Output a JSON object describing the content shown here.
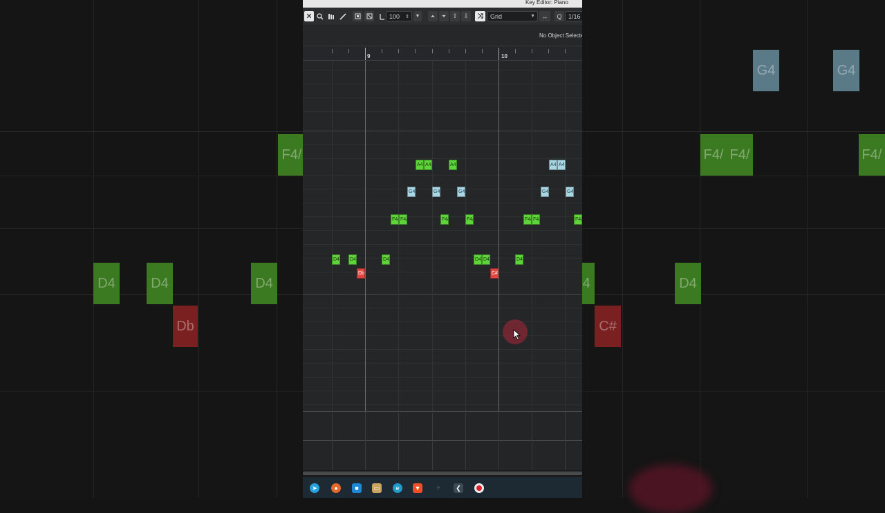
{
  "window": {
    "title": "Key Editor: Piano"
  },
  "toolbar": {
    "velocity_value": "100",
    "snap_type": "Grid",
    "quantize_label": "Q",
    "quantize_value": "1/16",
    "icons": [
      "close-icon",
      "zoom-icon",
      "mute-icon",
      "pencil-icon",
      "loop-icon",
      "auto-scroll-icon",
      "velocity-icon",
      "stepper-icon",
      "dropdown-icon",
      "move-up-icon",
      "move-down-icon",
      "push-up-icon",
      "push-down-icon",
      "snap-icon",
      "quantize-icon"
    ]
  },
  "info_line": {
    "status": "No Object Selected"
  },
  "ruler": {
    "bars": [
      "9",
      "10"
    ]
  },
  "notes": [
    {
      "label": "A4",
      "color": "green"
    },
    {
      "label": "A4",
      "color": "green"
    },
    {
      "label": "A4",
      "color": "green"
    },
    {
      "label": "A4",
      "color": "blue"
    },
    {
      "label": "A4",
      "color": "blue"
    },
    {
      "label": "G4",
      "color": "blue"
    },
    {
      "label": "G4",
      "color": "blue"
    },
    {
      "label": "G4",
      "color": "blue"
    },
    {
      "label": "G4",
      "color": "blue"
    },
    {
      "label": "G4",
      "color": "blue"
    },
    {
      "label": "F4/",
      "color": "green"
    },
    {
      "label": "F4/",
      "color": "green"
    },
    {
      "label": "F4/",
      "color": "green"
    },
    {
      "label": "F4/",
      "color": "green"
    },
    {
      "label": "F4/",
      "color": "green"
    },
    {
      "label": "F4/",
      "color": "green"
    },
    {
      "label": "F4/",
      "color": "green"
    },
    {
      "label": "D4",
      "color": "green"
    },
    {
      "label": "D4",
      "color": "green"
    },
    {
      "label": "D4",
      "color": "green"
    },
    {
      "label": "D4",
      "color": "green"
    },
    {
      "label": "D4",
      "color": "green"
    },
    {
      "label": "D4",
      "color": "green"
    },
    {
      "label": "Db",
      "color": "red"
    },
    {
      "label": "C#",
      "color": "red"
    }
  ],
  "background_notes": [
    "F4/",
    "D4",
    "D4",
    "D4",
    "Db",
    "G4",
    "G4",
    "F4/",
    "F4/",
    "F4/",
    "D4",
    "D4",
    "C#"
  ],
  "taskbar": {
    "icons": [
      "telegram-icon",
      "firefox-icon",
      "store-icon",
      "files-icon",
      "edge-icon",
      "brave-icon",
      "apps-icon",
      "cubase-icon",
      "record-icon"
    ]
  },
  "colors": {
    "note_green": "#5fd33a",
    "note_blue": "#a9d6e2",
    "note_red": "#e0463f",
    "background": "#141414"
  }
}
